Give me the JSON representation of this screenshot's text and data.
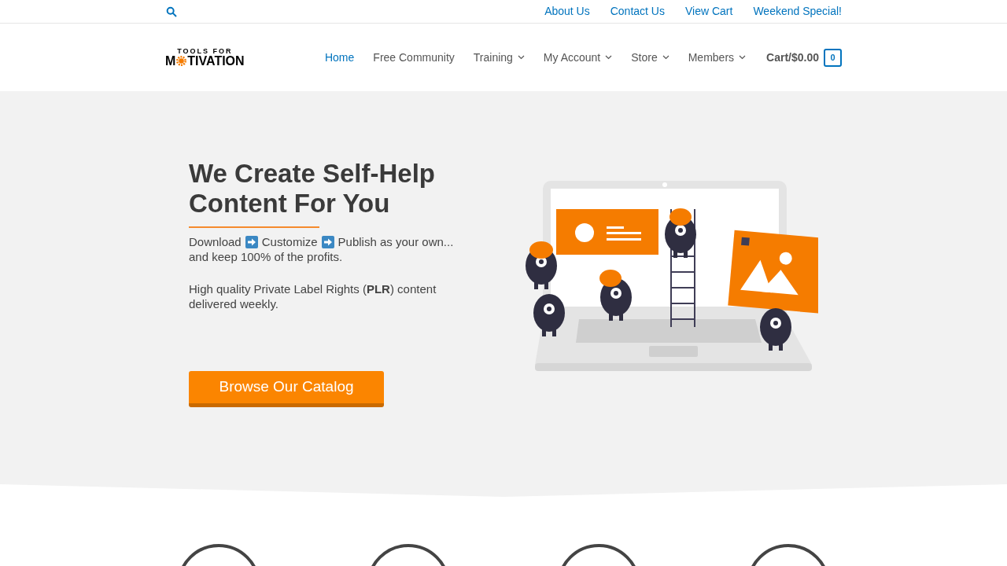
{
  "top_bar": {
    "links": [
      "About Us",
      "Contact Us",
      "View Cart",
      "Weekend Special!"
    ]
  },
  "logo": {
    "line_1": "TOOLS FOR",
    "line_2_before": "M",
    "line_2_after": "TIVATION"
  },
  "nav": [
    {
      "label": "Home",
      "selected": true,
      "dropdown": false
    },
    {
      "label": "Free Community",
      "selected": false,
      "dropdown": false
    },
    {
      "label": "Training",
      "selected": false,
      "dropdown": true
    },
    {
      "label": "My Account",
      "selected": false,
      "dropdown": true
    },
    {
      "label": "Store",
      "selected": false,
      "dropdown": true
    },
    {
      "label": "Members",
      "selected": false,
      "dropdown": true
    }
  ],
  "cart": {
    "label": "Cart/$0.00",
    "count": "0"
  },
  "hero": {
    "title": "We Create Self-Help Content For You",
    "steps": [
      "Download",
      "Customize",
      "Publish as your own..."
    ],
    "steps_tail": "and keep 100% of the profits.",
    "description": "High quality Private Label Rights (**PLR**) content delivered weekly.",
    "button": "Browse Our Catalog"
  },
  "features": [
    {
      "kind": "circle"
    },
    {
      "kind": "circle"
    },
    {
      "kind": "circle"
    },
    {
      "kind": "circle"
    }
  ]
}
